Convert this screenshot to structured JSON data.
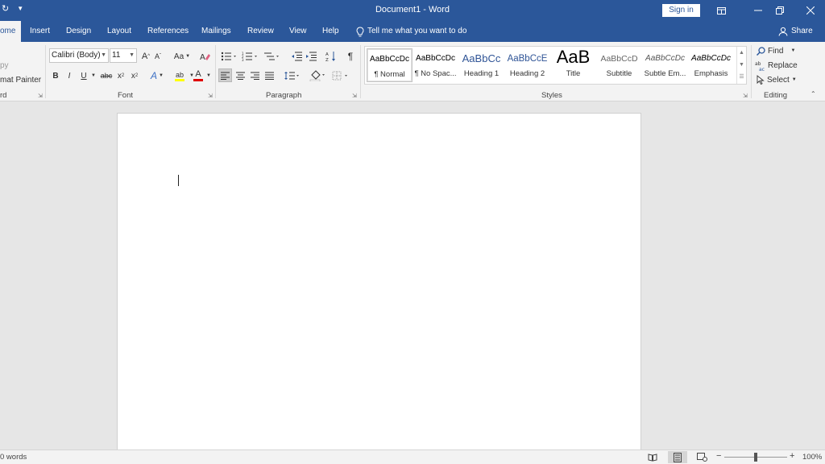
{
  "window": {
    "title": "Document1  -  Word",
    "sign_in": "Sign in",
    "colors": {
      "titlebar": "#2b579a",
      "ribbon": "#f3f3f3",
      "canvas": "#e6e6e6"
    }
  },
  "tabs": [
    {
      "label": "ome",
      "active": true
    },
    {
      "label": "Insert"
    },
    {
      "label": "Design"
    },
    {
      "label": "Layout"
    },
    {
      "label": "References"
    },
    {
      "label": "Mailings"
    },
    {
      "label": "Review"
    },
    {
      "label": "View"
    },
    {
      "label": "Help"
    }
  ],
  "tell_me": "Tell me what you want to do",
  "share": "Share",
  "clipboard": {
    "copy": "py",
    "format_painter": "mat Painter",
    "group_label": "rd"
  },
  "font": {
    "name": "Calibri (Body)",
    "size": "11",
    "grow": "A",
    "shrink": "A",
    "change_case": "Aa",
    "bold": "B",
    "italic": "I",
    "underline": "U",
    "strikethrough": "abc",
    "subscript": "x",
    "superscript": "x",
    "text_effects": "A",
    "highlight": "ab",
    "font_color": "A",
    "group_label": "Font",
    "colors": {
      "highlight": "#ffff00",
      "font_color": "#e00000"
    }
  },
  "paragraph": {
    "group_label": "Paragraph",
    "pilcrow": "¶"
  },
  "styles": {
    "group_label": "Styles",
    "items": [
      {
        "preview": "AaBbCcDc",
        "name": "¶ Normal",
        "selected": true
      },
      {
        "preview": "AaBbCcDc",
        "name": "¶ No Spac..."
      },
      {
        "preview": "AaBbCc",
        "name": "Heading 1"
      },
      {
        "preview": "AaBbCcE",
        "name": "Heading 2"
      },
      {
        "preview": "AaB",
        "name": "Title"
      },
      {
        "preview": "AaBbCcD",
        "name": "Subtitle"
      },
      {
        "preview": "AaBbCcDc",
        "name": "Subtle Em..."
      },
      {
        "preview": "AaBbCcDc",
        "name": "Emphasis"
      }
    ]
  },
  "editing": {
    "find": "Find",
    "replace": "Replace",
    "select": "Select",
    "group_label": "Editing"
  },
  "status": {
    "word_count": "0 words",
    "zoom": "100%",
    "zoom_level": 1.0
  }
}
